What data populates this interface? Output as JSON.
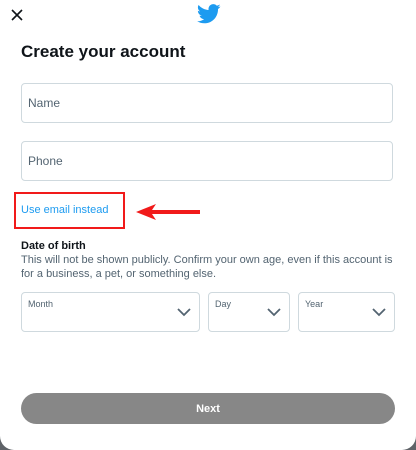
{
  "header": {
    "close_icon": "close-icon",
    "logo_icon": "twitter-bird-icon",
    "brand_color": "#1d9bf0"
  },
  "title": "Create your account",
  "fields": {
    "name_placeholder": "Name",
    "phone_placeholder": "Phone"
  },
  "switch_link": "Use email instead",
  "annotation": {
    "highlight_color": "#f11a1a"
  },
  "dob": {
    "title": "Date of birth",
    "description": "This will not be shown publicly. Confirm your own age, even if this account is for a business, a pet, or something else.",
    "month_label": "Month",
    "day_label": "Day",
    "year_label": "Year"
  },
  "next_button": "Next"
}
